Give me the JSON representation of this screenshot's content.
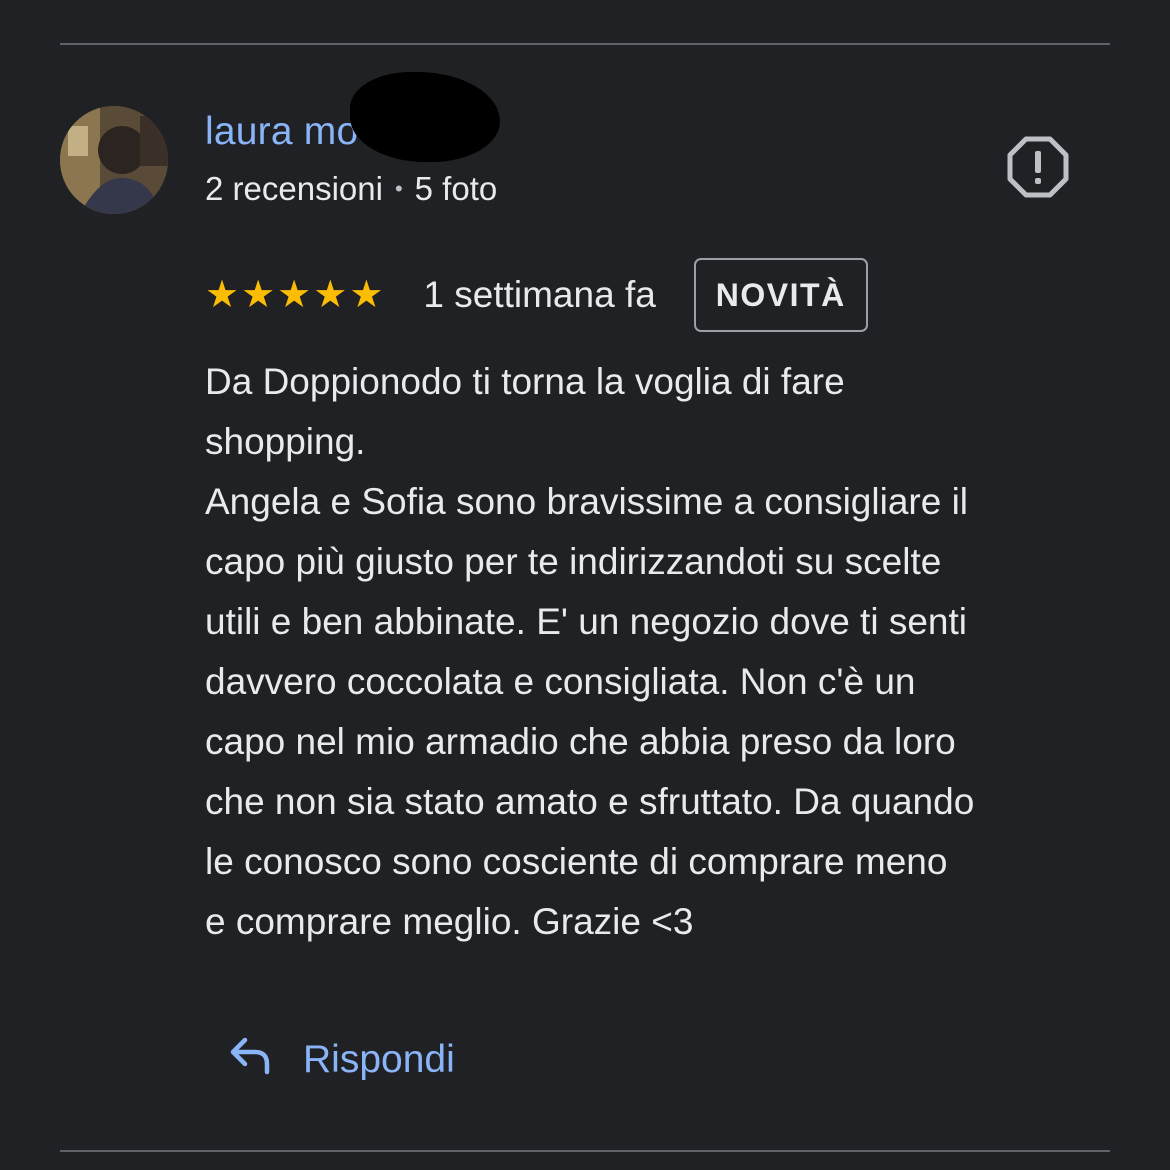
{
  "review": {
    "author_name": "laura mo",
    "reviews_count": "2 recensioni",
    "separator": "•",
    "photos_count": "5 foto",
    "stars": [
      "★",
      "★",
      "★",
      "★",
      "★"
    ],
    "rating": 5,
    "time_ago": "1 settimana fa",
    "badge": "NOVITÀ",
    "text_lines": [
      "Da Doppionodo ti torna la voglia di fare",
      "shopping.",
      "Angela e Sofia sono bravissime a consigliare il",
      "capo più giusto per te indirizzandoti su scelte",
      "utili e ben abbinate. E' un negozio dove ti senti",
      "davvero coccolata e consigliata. Non c'è un",
      "capo nel mio armadio che abbia preso da loro",
      "che non sia stato amato e sfruttato. Da quando",
      "le conosco sono cosciente di comprare meno",
      "e comprare meglio. Grazie <3"
    ],
    "reply_label": "Rispondi"
  },
  "icons": {
    "report": "report-octagon-icon",
    "reply": "reply-arrow-icon",
    "star": "star-icon"
  },
  "colors": {
    "background": "#202124",
    "link_blue": "#8ab4f8",
    "star_yellow": "#fbbc04",
    "text": "#e8eaed",
    "divider": "#5f6368"
  }
}
